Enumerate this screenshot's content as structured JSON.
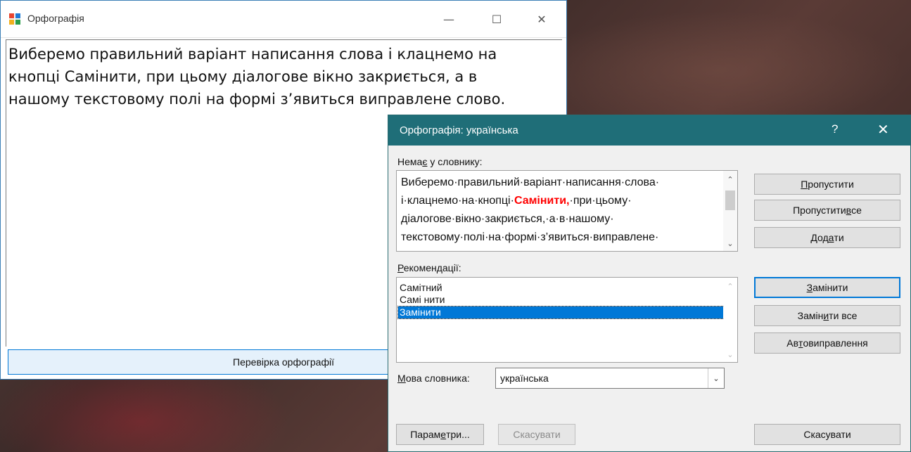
{
  "main_window": {
    "title": "Орфографія",
    "minimize": "—",
    "maximize": "☐",
    "close": "✕",
    "text_lines": [
      "Виберемо правильний варіант написання слова і клацнемо на",
      "кнопці Самінити, при цьому діалогове вікно закриється, а в",
      "нашому текстовому полі на формі з’явиться виправлене слово."
    ],
    "check_button": "Перевірка орфографії"
  },
  "dialog": {
    "title": "Орфографія: українська",
    "help": "?",
    "close": "✕",
    "not_in_dict_label_pre": "Нема",
    "not_in_dict_label_u": "є",
    "not_in_dict_label_post": " у словнику:",
    "not_in_dict_lines": {
      "l1": "Виберемо·правильний·варіант·написання·слова·",
      "l2_pre": "і·клацнемо·на·кнопці·",
      "l2_bad": "Самінити,",
      "l2_post": "·при·цьому·",
      "l3": "діалогове·вікно·закриється,·а·в·нашому·",
      "l4": "текстовому·полі·на·формі·з’явиться·виправлене·"
    },
    "suggestions_label_u": "Р",
    "suggestions_label_rest": "екомендації:",
    "suggestions": [
      "Самітний",
      "Самі нити",
      "Замінити"
    ],
    "selected_suggestion": "Замінити",
    "lang_label_u": "М",
    "lang_label_rest": "ова словника:",
    "lang_value": "українська",
    "buttons": {
      "ignore_u": "П",
      "ignore_rest": "ропустити",
      "ignore_all_pre": "Пропустити ",
      "ignore_all_u": "в",
      "ignore_all_post": "се",
      "add_pre": "Дод",
      "add_u": "а",
      "add_post": "ти",
      "change_u": "З",
      "change_rest": "амінити",
      "change_all_pre": "Замін",
      "change_all_u": "и",
      "change_all_post": "ти все",
      "autocorrect_pre": "Ав",
      "autocorrect_u": "т",
      "autocorrect_post": "овиправлення",
      "options_pre": "Парам",
      "options_u": "е",
      "options_post": "три...",
      "undo": "Скасувати",
      "cancel": "Скасувати"
    }
  }
}
